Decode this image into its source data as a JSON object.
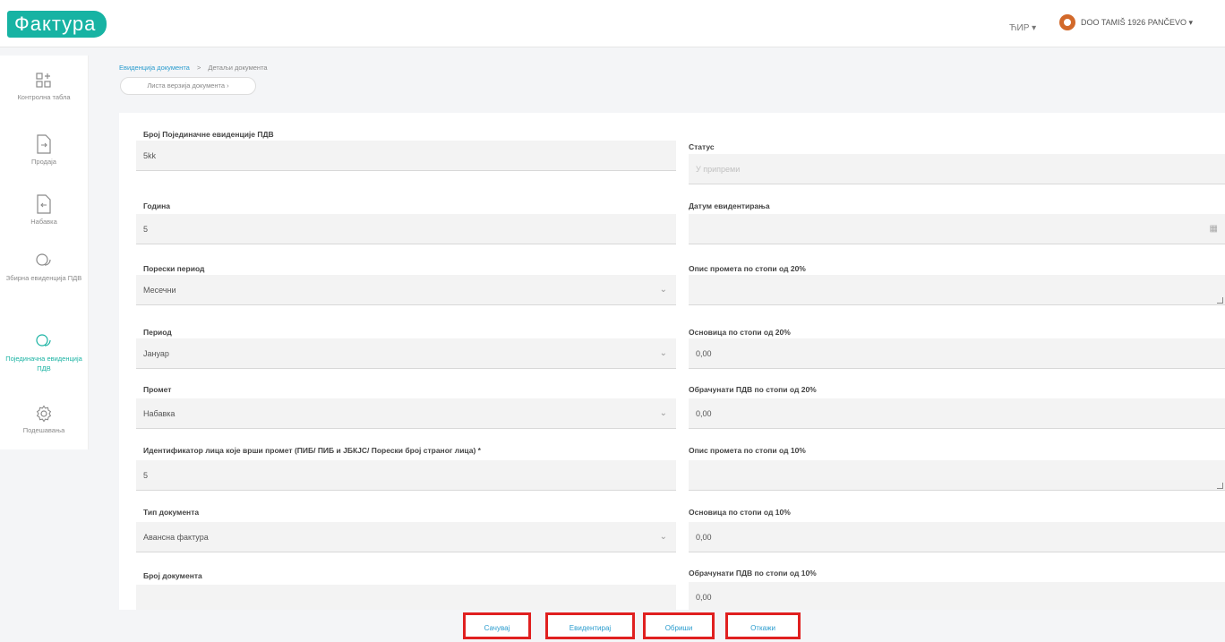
{
  "app": {
    "logo": "Фактура"
  },
  "header": {
    "language": "ЋИР ▾",
    "company": "DOO TAMIŠ 1926 PANČEVO ▾"
  },
  "sidebar": {
    "items": [
      {
        "label": "Контролна табла",
        "icon": "dashboard-icon"
      },
      {
        "label": "Продаја",
        "icon": "document-out-icon"
      },
      {
        "label": "Набавка",
        "icon": "document-in-icon"
      },
      {
        "label": "Збирна евиденција ПДВ",
        "icon": "chat-icon"
      },
      {
        "label": "Појединачна евиденција ПДВ",
        "icon": "chat-icon",
        "active": true
      },
      {
        "label": "Подешавања",
        "icon": "gear-icon"
      }
    ]
  },
  "breadcrumb": {
    "link": "Евиденција документа",
    "separator": ">",
    "current": "Детаљи документа"
  },
  "pill_label": "Листа верзија документа ›",
  "form": {
    "left": [
      {
        "label": "Број Појединачне евиденције ПДВ",
        "value": "5kk"
      },
      {
        "label": "Година",
        "value": "5"
      },
      {
        "label": "Порески период",
        "value": "Месечни"
      },
      {
        "label": "Период",
        "value": "Јануар"
      },
      {
        "label": "Промет",
        "value": "Набавка"
      },
      {
        "label": "Идентификатор лица које врши промет (ПИБ/ ПИБ и ЈБКЈС/ Порески број страног лица) *",
        "value": "5"
      },
      {
        "label": "Тип документа",
        "value": "Авансна фактура"
      },
      {
        "label": "Број документа",
        "value": ""
      }
    ],
    "right": [
      {
        "label": "Статус",
        "value": "",
        "placeholder": "У припреми"
      },
      {
        "label": "Датум евидентирања",
        "value": ""
      },
      {
        "label": "Опис промета по стопи од 20%",
        "value": ""
      },
      {
        "label": "Основица по стопи од 20%",
        "value": "0,00"
      },
      {
        "label": "Обрачунати ПДВ по стопи од 20%",
        "value": "0,00"
      },
      {
        "label": "Опис промета по стопи од 10%",
        "value": ""
      },
      {
        "label": "Основица по стопи од 10%",
        "value": "0,00"
      },
      {
        "label": "Обрачунати ПДВ по стопи од 10%",
        "value": "0,00"
      }
    ]
  },
  "actions": {
    "save": "Сачувај",
    "record": "Евидентирај",
    "delete": "Обриши",
    "cancel": "Откажи"
  },
  "colors": {
    "accent": "#17b3a3",
    "link": "#2a9cce",
    "highlight": "#e02020"
  }
}
